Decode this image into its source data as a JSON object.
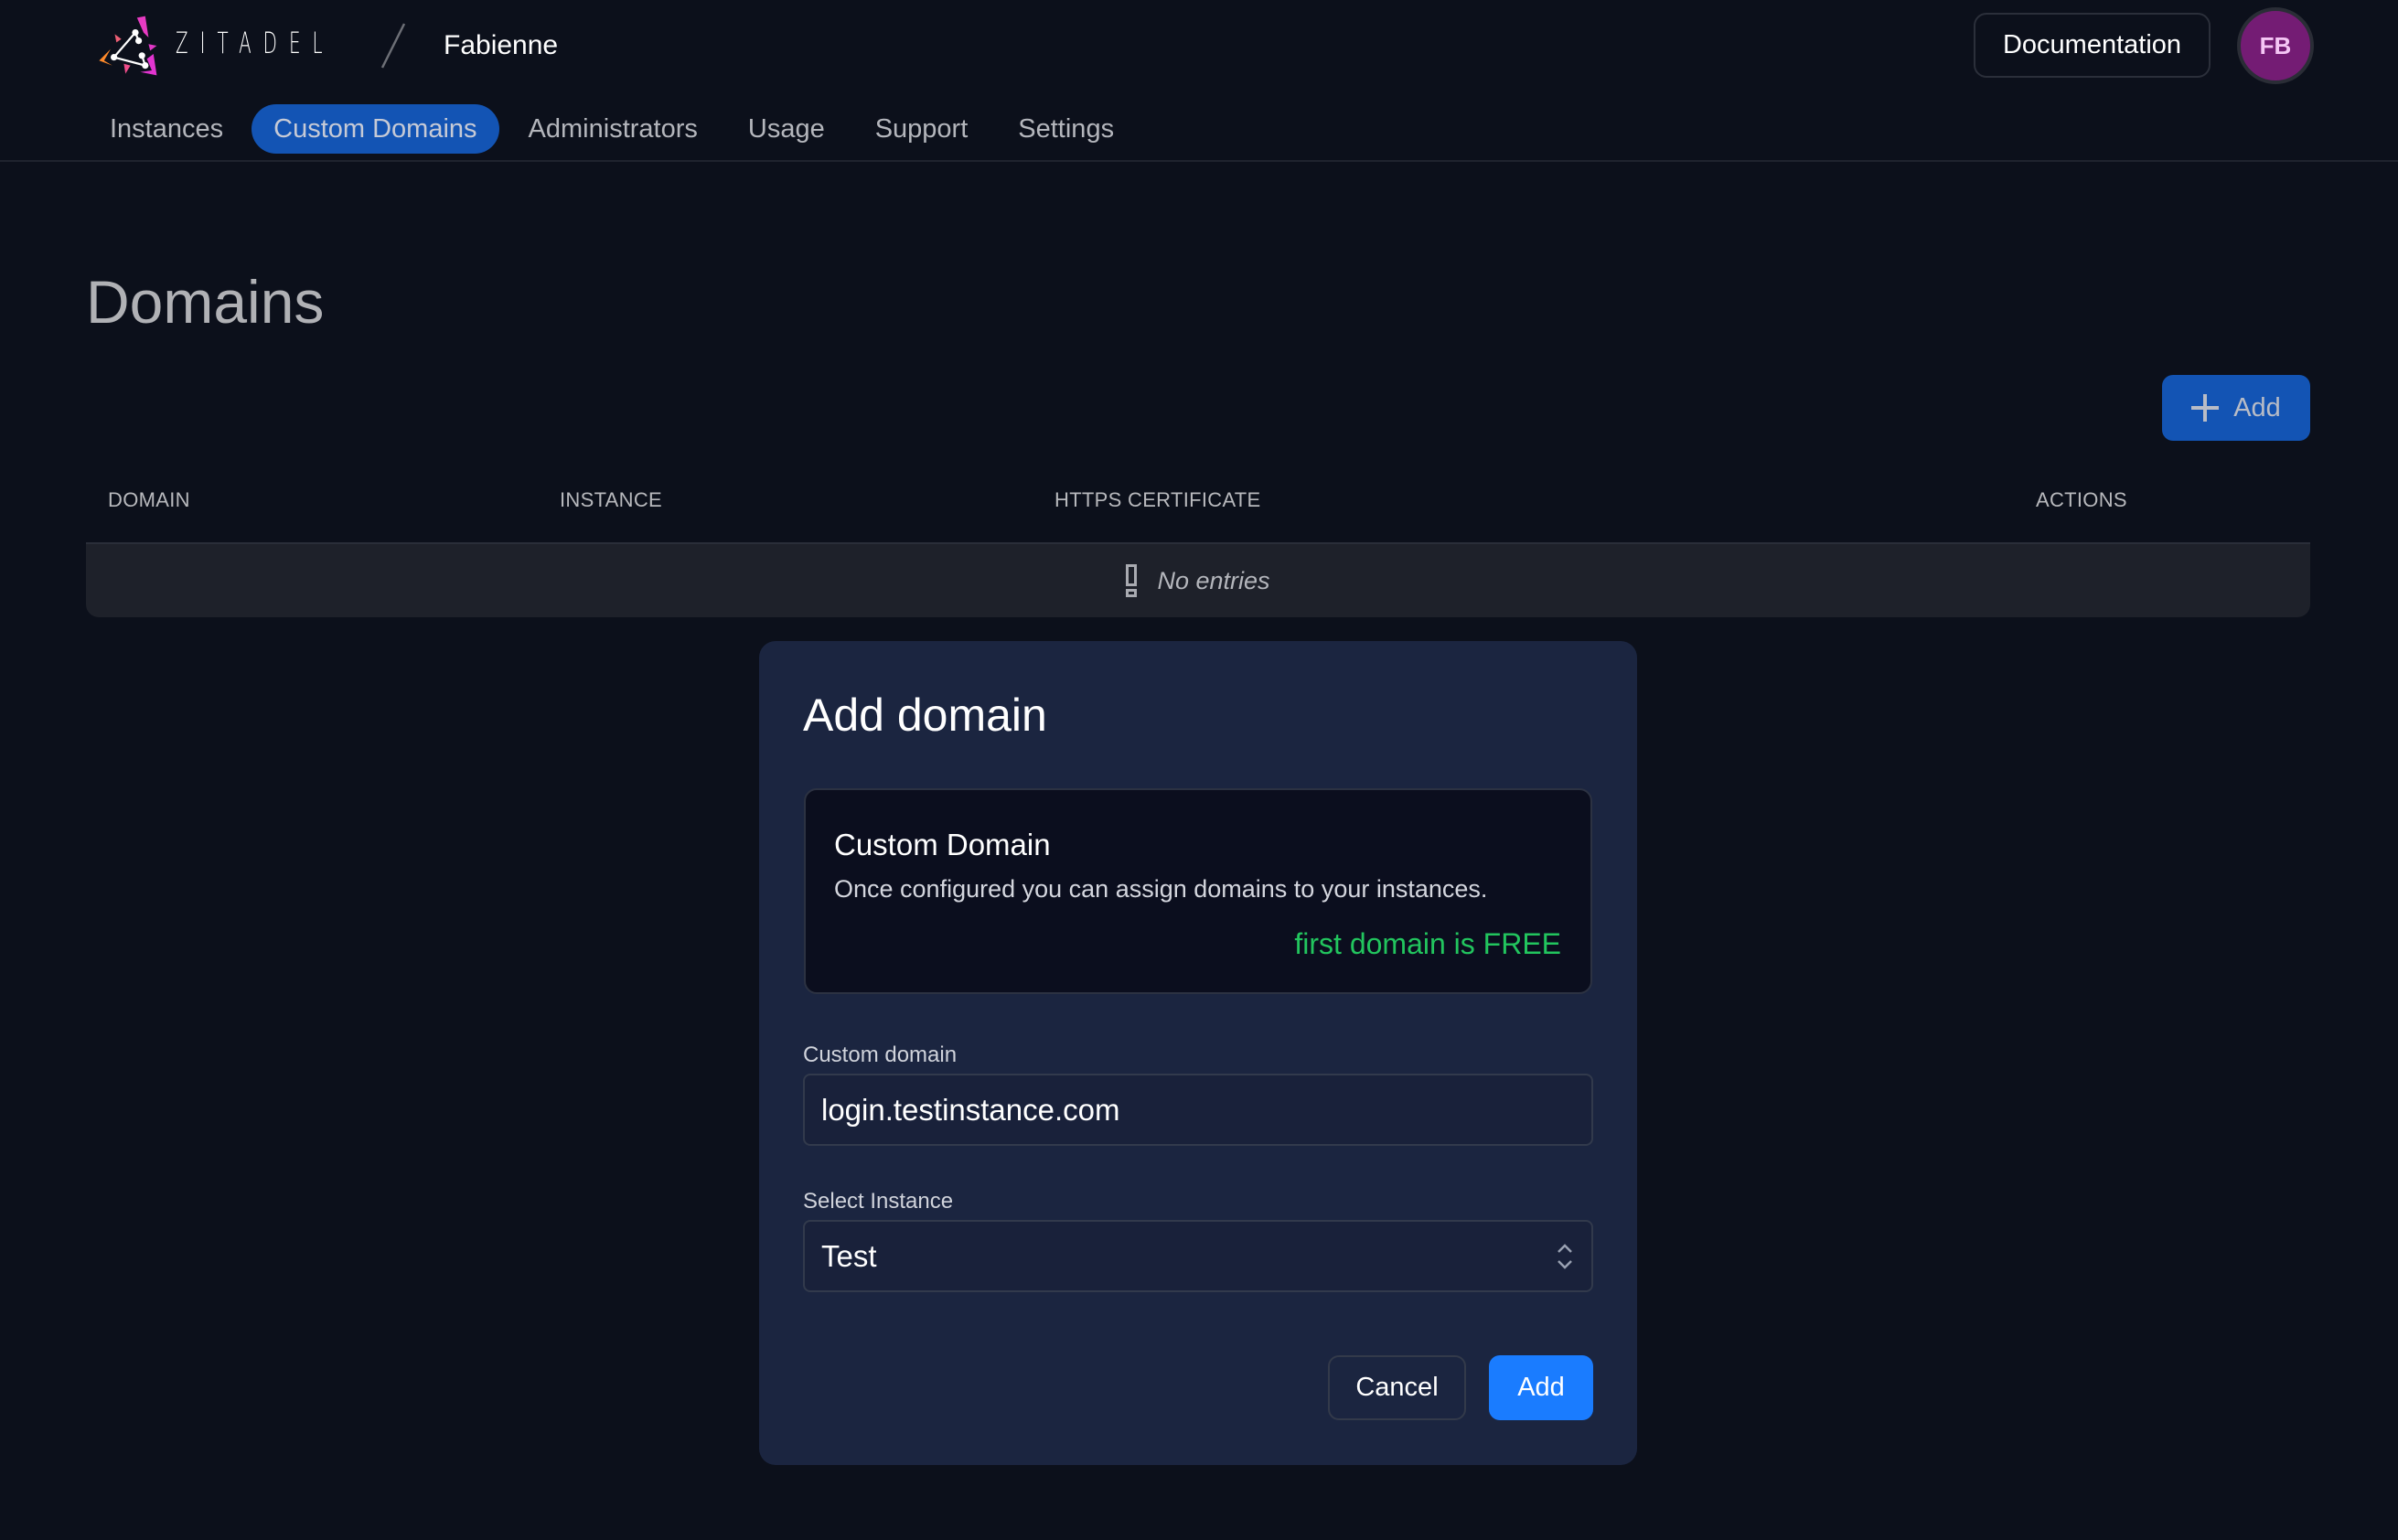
{
  "header": {
    "brand": "ZITADEL",
    "org_name": "Fabienne",
    "documentation_label": "Documentation",
    "avatar_initials": "FB",
    "avatar_color": "#741c74"
  },
  "nav": {
    "items": [
      {
        "label": "Instances",
        "active": false
      },
      {
        "label": "Custom Domains",
        "active": true
      },
      {
        "label": "Administrators",
        "active": false
      },
      {
        "label": "Usage",
        "active": false
      },
      {
        "label": "Support",
        "active": false
      },
      {
        "label": "Settings",
        "active": false
      }
    ],
    "active_color": "#1354b4"
  },
  "page": {
    "title": "Domains",
    "add_label": "Add",
    "add_icon": "plus-icon"
  },
  "table": {
    "columns": [
      "DOMAIN",
      "INSTANCE",
      "HTTPS CERTIFICATE",
      "ACTIONS"
    ],
    "rows": [],
    "empty_text": "No entries",
    "empty_icon": "exclamation-icon"
  },
  "modal": {
    "title": "Add domain",
    "info": {
      "title": "Custom Domain",
      "description": "Once configured you can assign domains to your instances.",
      "highlight": "first domain is FREE",
      "highlight_color": "#22c55e"
    },
    "domain_field": {
      "label": "Custom domain",
      "value": "login.testinstance.com"
    },
    "instance_field": {
      "label": "Select Instance",
      "value": "Test"
    },
    "cancel_label": "Cancel",
    "add_label": "Add",
    "add_color": "#1a7cff"
  }
}
